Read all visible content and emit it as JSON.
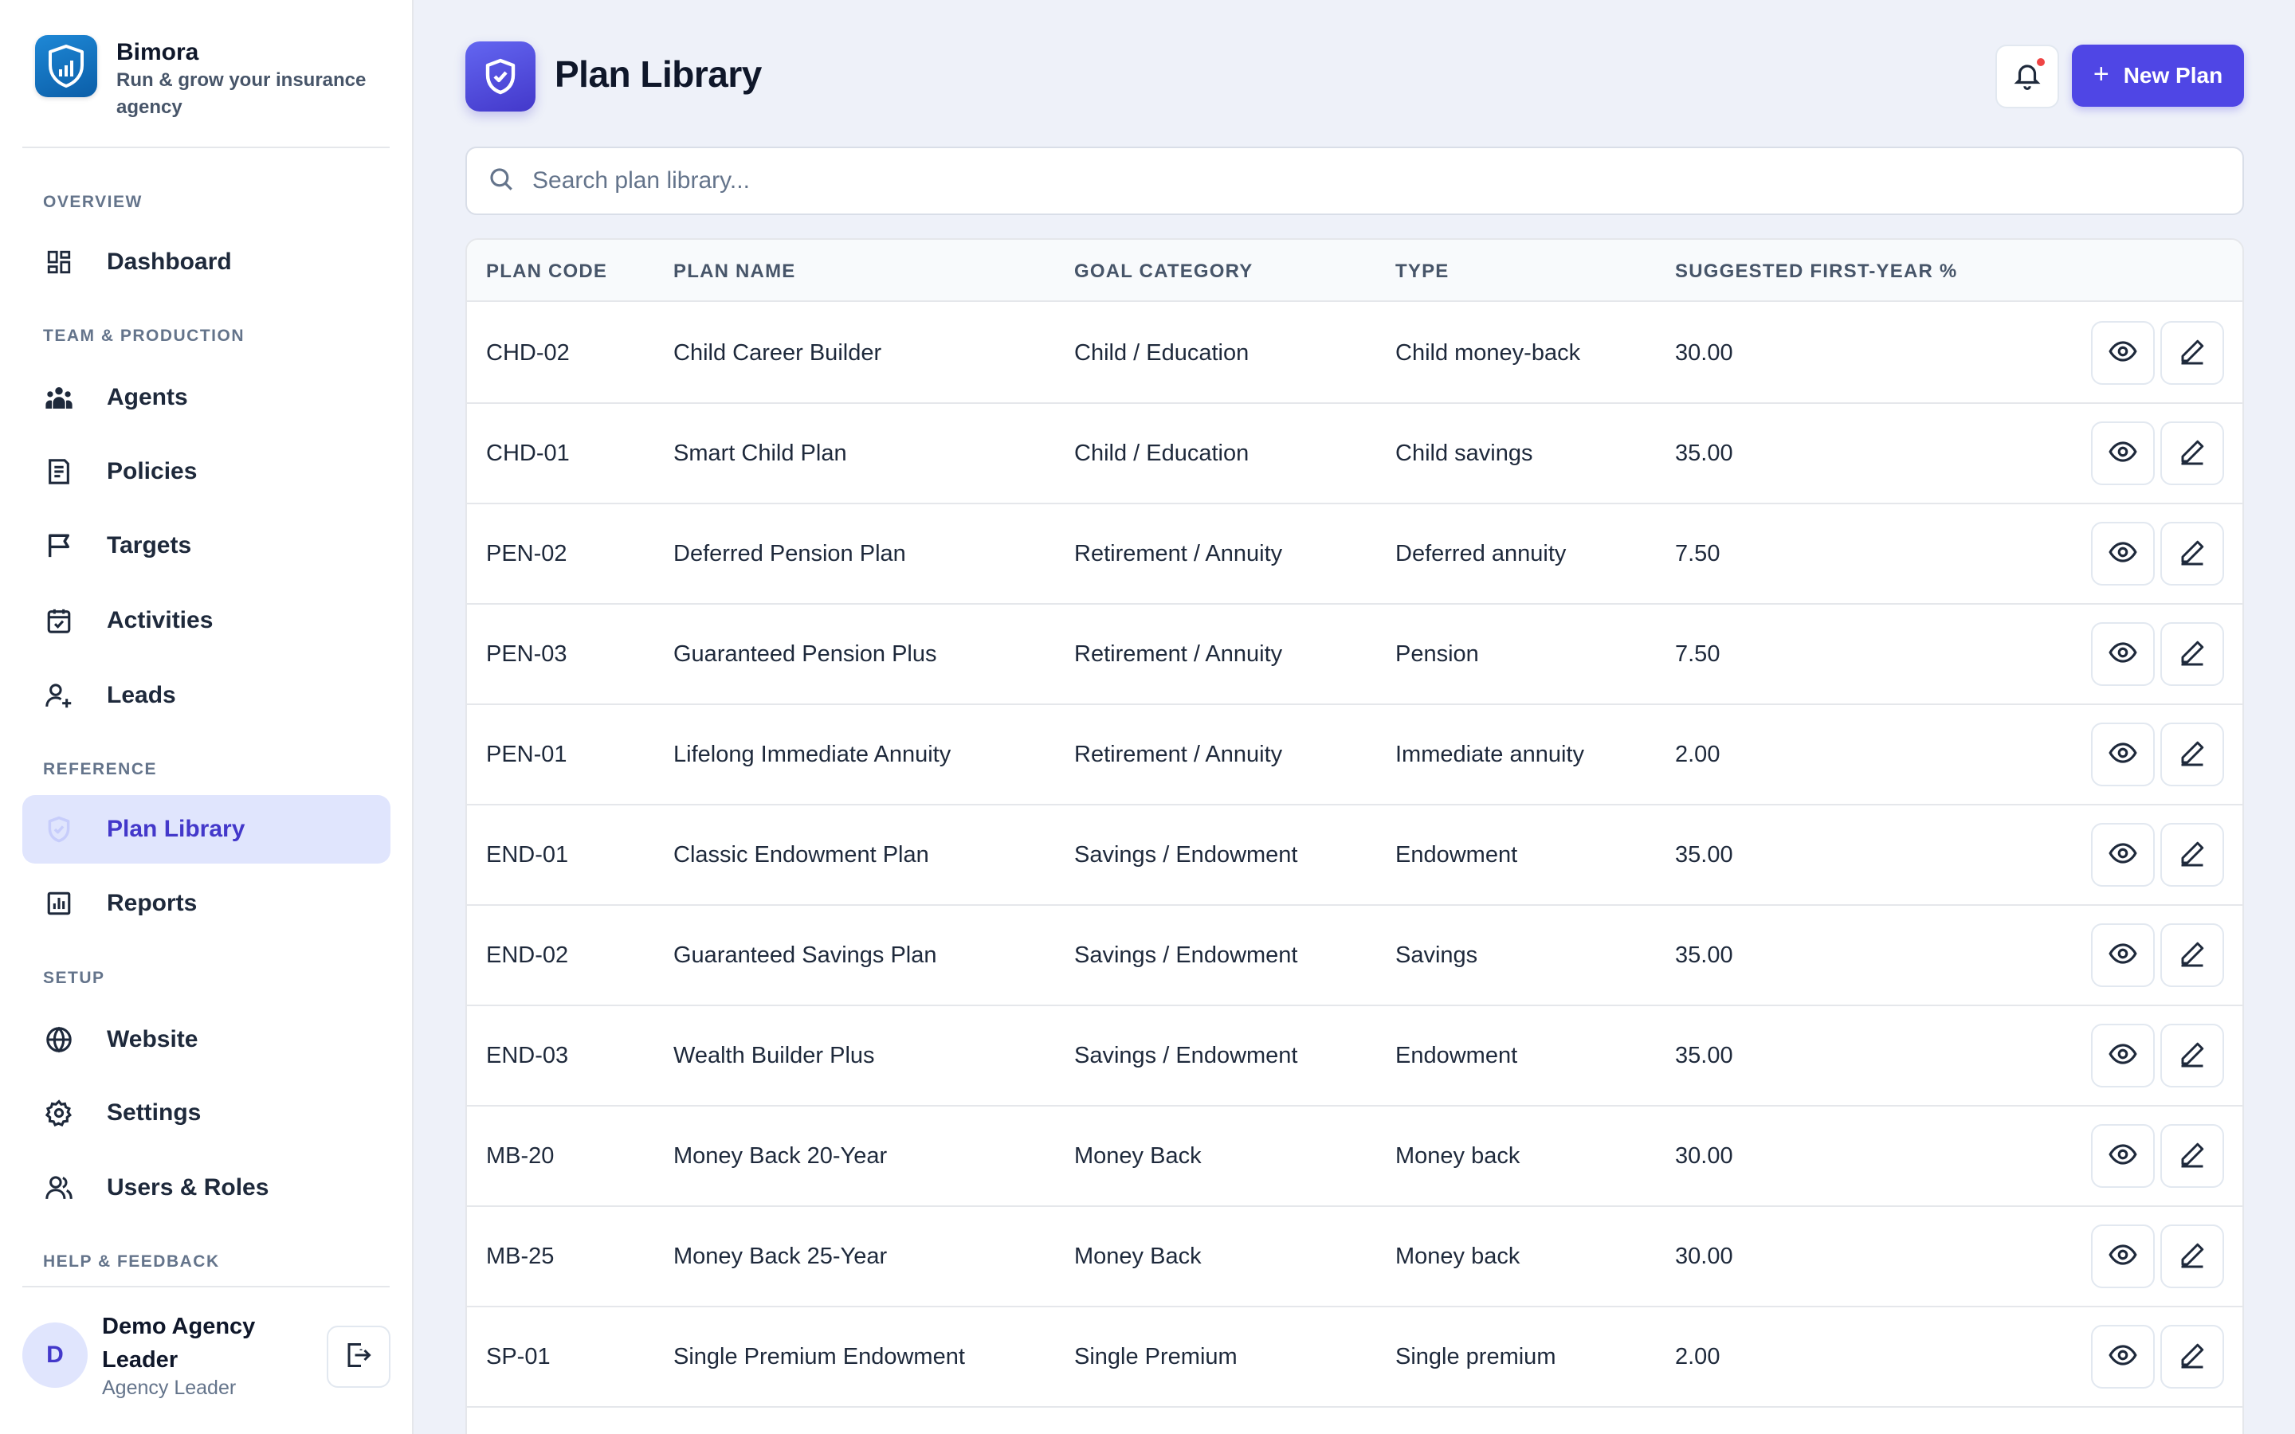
{
  "brand": {
    "name": "Bimora",
    "tagline": "Run & grow your insurance agency",
    "icon": "shield-chart-icon"
  },
  "sidebar": {
    "sections": [
      {
        "title": "OVERVIEW"
      },
      {
        "title": "TEAM & PRODUCTION"
      },
      {
        "title": "REFERENCE"
      },
      {
        "title": "SETUP"
      },
      {
        "title": "HELP & FEEDBACK"
      }
    ],
    "items": [
      {
        "label": "Dashboard",
        "icon": "dashboard-icon"
      },
      {
        "label": "Agents",
        "icon": "team-icon"
      },
      {
        "label": "Policies",
        "icon": "document-icon"
      },
      {
        "label": "Targets",
        "icon": "flag-icon"
      },
      {
        "label": "Activities",
        "icon": "calendar-icon"
      },
      {
        "label": "Leads",
        "icon": "user-plus-icon"
      },
      {
        "label": "Plan Library",
        "icon": "shield-check-icon",
        "active": true
      },
      {
        "label": "Reports",
        "icon": "bar-chart-icon"
      },
      {
        "label": "Website",
        "icon": "globe-icon"
      },
      {
        "label": "Settings",
        "icon": "gear-icon"
      },
      {
        "label": "Users & Roles",
        "icon": "users-icon"
      }
    ]
  },
  "user": {
    "initial": "D",
    "name": "Demo Agency Leader",
    "role": "Agency Leader"
  },
  "header": {
    "title": "Plan Library",
    "new_button": "New Plan",
    "plus": "+"
  },
  "search": {
    "placeholder": "Search plan library..."
  },
  "table": {
    "columns": [
      "PLAN CODE",
      "PLAN NAME",
      "GOAL CATEGORY",
      "TYPE",
      "SUGGESTED FIRST-YEAR %"
    ],
    "rows": [
      [
        "CHD-02",
        "Child Career Builder",
        "Child / Education",
        "Child money-back",
        "30.00"
      ],
      [
        "CHD-01",
        "Smart Child Plan",
        "Child / Education",
        "Child savings",
        "35.00"
      ],
      [
        "PEN-02",
        "Deferred Pension Plan",
        "Retirement / Annuity",
        "Deferred annuity",
        "7.50"
      ],
      [
        "PEN-03",
        "Guaranteed Pension Plus",
        "Retirement / Annuity",
        "Pension",
        "7.50"
      ],
      [
        "PEN-01",
        "Lifelong Immediate Annuity",
        "Retirement / Annuity",
        "Immediate annuity",
        "2.00"
      ],
      [
        "END-01",
        "Classic Endowment Plan",
        "Savings / Endowment",
        "Endowment",
        "35.00"
      ],
      [
        "END-02",
        "Guaranteed Savings Plan",
        "Savings / Endowment",
        "Savings",
        "35.00"
      ],
      [
        "END-03",
        "Wealth Builder Plus",
        "Savings / Endowment",
        "Endowment",
        "35.00"
      ],
      [
        "MB-20",
        "Money Back 20-Year",
        "Money Back",
        "Money back",
        "30.00"
      ],
      [
        "MB-25",
        "Money Back 25-Year",
        "Money Back",
        "Money back",
        "30.00"
      ],
      [
        "SP-01",
        "Single Premium Endowment",
        "Single Premium",
        "Single premium",
        "2.00"
      ]
    ]
  },
  "colors": {
    "accent": "#4f46e5",
    "active_bg": "#e0e5fd",
    "notification": "#ef4444"
  }
}
